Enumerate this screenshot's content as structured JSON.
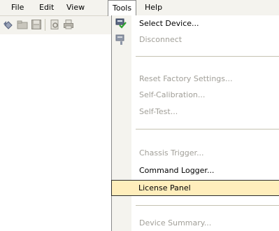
{
  "menubar": {
    "items": [
      {
        "label": "File"
      },
      {
        "label": "Edit"
      },
      {
        "label": "View"
      },
      {
        "label": "Tools"
      },
      {
        "label": "Help"
      }
    ],
    "open_menu": "Tools"
  },
  "toolbar": {
    "icons": [
      "refresh-icon",
      "open-folder-icon",
      "save-icon",
      "print-preview-icon",
      "print-icon"
    ]
  },
  "tools_menu": {
    "items": [
      {
        "label": "Select Device...",
        "enabled": true,
        "icon": "device-connect-icon"
      },
      {
        "label": "Disconnect",
        "enabled": false,
        "icon": "device-disconnect-icon"
      },
      {
        "label": "Reset Factory Settings...",
        "enabled": false
      },
      {
        "label": "Self-Calibration...",
        "enabled": false
      },
      {
        "label": "Self-Test...",
        "enabled": false
      },
      {
        "label": "Chassis Trigger...",
        "enabled": false
      },
      {
        "label": "Command Logger...",
        "enabled": true
      },
      {
        "label": "License Panel",
        "enabled": true,
        "highlighted": true
      },
      {
        "label": "Device Summary...",
        "enabled": false
      }
    ]
  },
  "colors": {
    "menu_bar_bg": "#f4f3ee",
    "highlight_bg": "#ffeebc",
    "disabled_text": "#a19f98",
    "separator": "#c5c2b2"
  }
}
